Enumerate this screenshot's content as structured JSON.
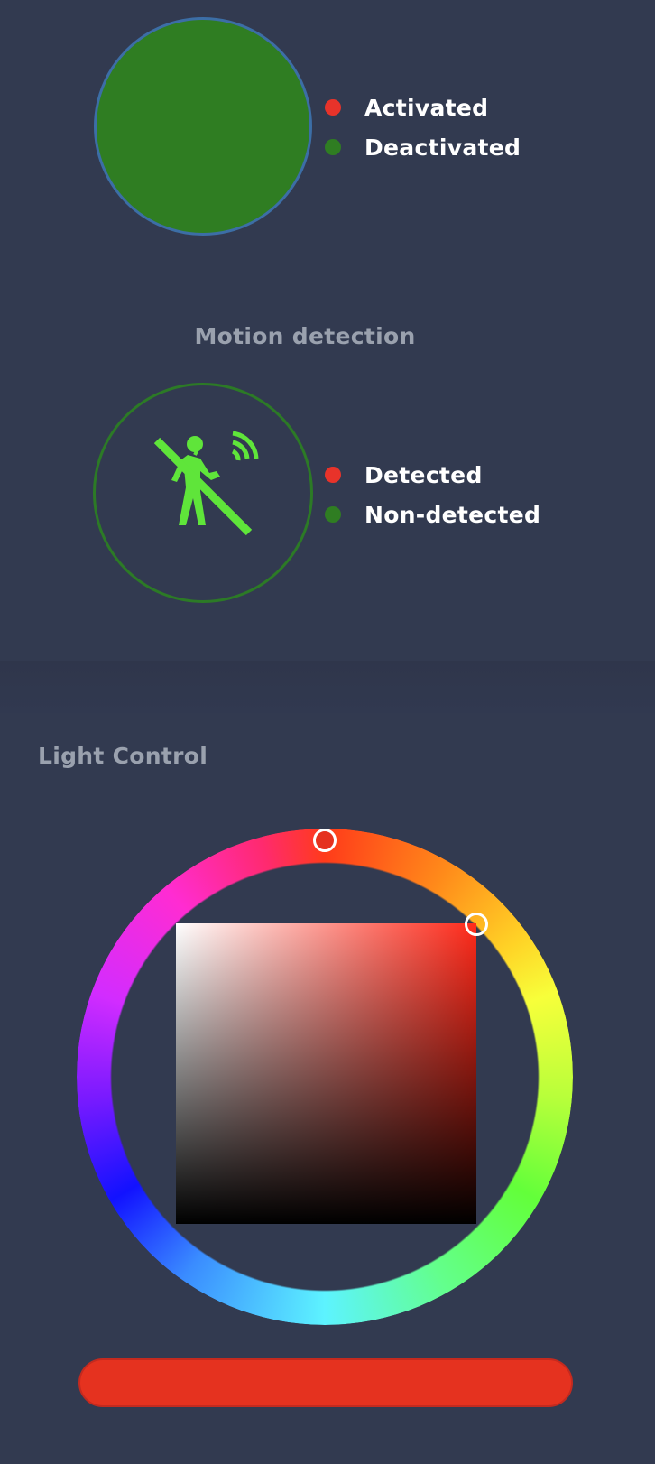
{
  "status": {
    "current_color": "#2f7d22",
    "legend": [
      {
        "label": "Activated",
        "color": "#e8332a"
      },
      {
        "label": "Deactivated",
        "color": "#2f7d22"
      }
    ]
  },
  "motion": {
    "title": "Motion detection",
    "icon": "no-motion-person-icon",
    "icon_color": "#5fe53a",
    "legend": [
      {
        "label": "Detected",
        "color": "#e8332a"
      },
      {
        "label": "Non-detected",
        "color": "#2f7d22"
      }
    ]
  },
  "light_control": {
    "title": "Light Control",
    "selected_color": "#e5321f",
    "hue_degrees": 2
  }
}
